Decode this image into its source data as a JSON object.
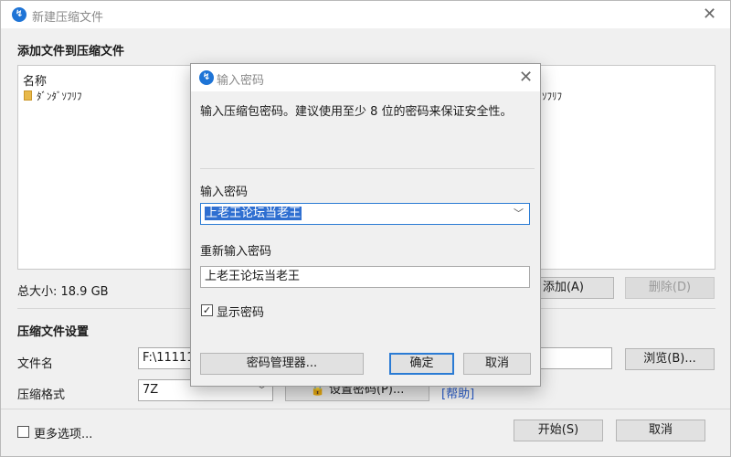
{
  "main": {
    "title": "新建压缩文件",
    "add_files_heading": "添加文件到压缩文件",
    "list_header_name": "名称",
    "list_items": [
      "ﾀﾞﾝﾀﾞｿﾌﾘﾌ"
    ],
    "list_item_behind_dialog": "ｿﾌﾘﾌ",
    "total_size": "总大小: 18.9 GB",
    "add_button": "添加(A)",
    "delete_button": "删除(D)",
    "settings_heading": "压缩文件设置",
    "filename_label": "文件名",
    "filename_value": "F:\\111111",
    "browse_button": "浏览(B)...",
    "format_label": "压缩格式",
    "format_value": "7Z",
    "set_password_button": "设置密码(P)...",
    "help_link": "[帮助]",
    "more_options_label": "更多选项...",
    "start_button": "开始(S)",
    "cancel_button": "取消"
  },
  "dialog": {
    "title": "输入密码",
    "instruction": "输入压缩包密码。建议使用至少 8 位的密码来保证安全性。",
    "password_label": "输入密码",
    "password_value": "上老王论坛当老王",
    "confirm_label": "重新输入密码",
    "confirm_value": "上老王论坛当老王",
    "show_password_label": "显示密码",
    "show_password_checked": true,
    "manager_button": "密码管理器...",
    "ok_button": "确定",
    "cancel_button": "取消"
  },
  "icons": {
    "app_icon": "bandizip-logo-icon",
    "folder_icon": "folder-icon",
    "lock_icon": "lock-icon",
    "close_icon": "close-icon",
    "dropdown_icon": "chevron-down-icon"
  },
  "colors": {
    "accent": "#2a7bd4",
    "selection": "#2f6fd1",
    "link": "#2a5cc8"
  }
}
